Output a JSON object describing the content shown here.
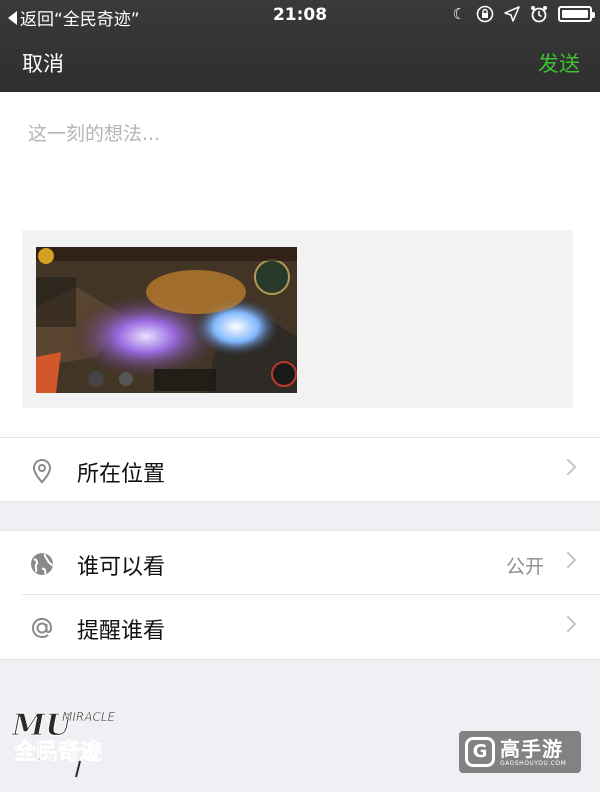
{
  "status_bar": {
    "back_text": "返回“全民奇迹”",
    "time": "21:08",
    "icons": [
      "moon-icon",
      "rotation-lock-icon",
      "location-arrow-icon",
      "alarm-icon",
      "battery-icon"
    ]
  },
  "nav": {
    "cancel_label": "取消",
    "send_label": "发送",
    "send_color": "#3ec12f"
  },
  "compose": {
    "placeholder": "这一刻的想法..."
  },
  "rows": {
    "location": {
      "label": "所在位置",
      "icon": "location-pin-icon"
    },
    "visibility": {
      "label": "谁可以看",
      "value": "公开",
      "icon": "globe-icon"
    },
    "mention": {
      "label": "提醒谁看",
      "icon": "at-sign-icon"
    }
  },
  "watermarks": {
    "left_logo_text": "MIRACLE",
    "left_logo_cn": "全民奇迹",
    "right_logo_cn": "高手游",
    "right_logo_en": "GAOSHOUYOU.COM"
  }
}
